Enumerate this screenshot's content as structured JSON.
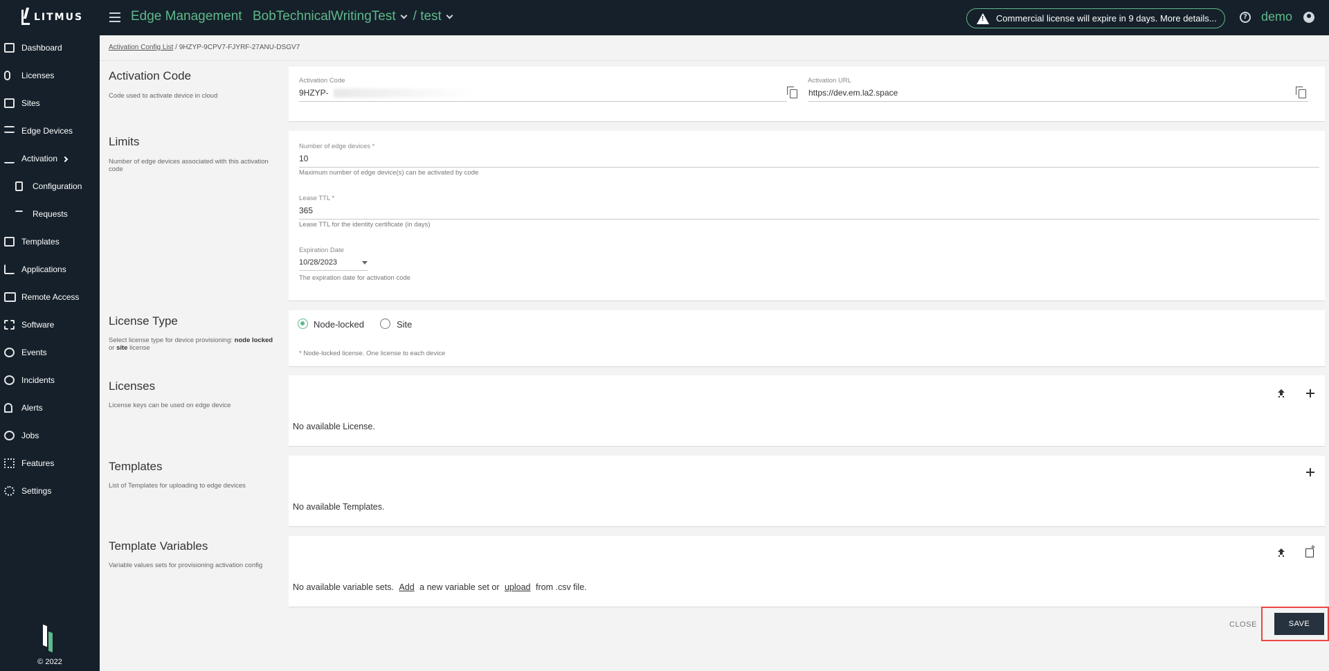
{
  "header": {
    "brand": "LITMUS",
    "app_title": "Edge Management",
    "company": "BobTechnicalWritingTest",
    "project": "/ test",
    "license_notice": "Commercial license will expire in 9 days. More details...",
    "user": "demo"
  },
  "sidebar": {
    "items": [
      {
        "label": "Dashboard",
        "icon": "dashboard-icon"
      },
      {
        "label": "Licenses",
        "icon": "paperclip-icon"
      },
      {
        "label": "Sites",
        "icon": "building-icon"
      },
      {
        "label": "Edge Devices",
        "icon": "list-icon"
      },
      {
        "label": "Activation",
        "icon": "checklist-icon"
      },
      {
        "label": "Configuration",
        "icon": "config-icon"
      },
      {
        "label": "Requests",
        "icon": "requests-icon"
      },
      {
        "label": "Templates",
        "icon": "template-icon"
      },
      {
        "label": "Applications",
        "icon": "cart-icon"
      },
      {
        "label": "Remote Access",
        "icon": "network-icon"
      },
      {
        "label": "Software",
        "icon": "chip-icon"
      },
      {
        "label": "Events",
        "icon": "history-icon"
      },
      {
        "label": "Incidents",
        "icon": "alert-circle-icon"
      },
      {
        "label": "Alerts",
        "icon": "bell-icon"
      },
      {
        "label": "Jobs",
        "icon": "clock-icon"
      },
      {
        "label": "Features",
        "icon": "apps-grid-icon"
      },
      {
        "label": "Settings",
        "icon": "gear-icon"
      }
    ],
    "copyright": "© 2022"
  },
  "breadcrumb": {
    "link": "Activation Config List",
    "current": "/ 9HZYP-9CPV7-FJYRF-27ANU-DSGV7"
  },
  "activation": {
    "title": "Activation Code",
    "desc": "Code used to activate device in cloud",
    "code_label": "Activation Code",
    "code_value": "9HZYP-",
    "url_label": "Activation URL",
    "url_value": "https://dev.em.la2.space"
  },
  "limits": {
    "title": "Limits",
    "desc": "Number of edge devices associated with this activation code",
    "devices_label": "Number of edge devices *",
    "devices_value": "10",
    "devices_hint": "Maximum number of edge device(s) can be activated by code",
    "ttl_label": "Lease TTL *",
    "ttl_value": "365",
    "ttl_hint": "Lease TTL for the identity certificate (in days)",
    "exp_label": "Expiration Date",
    "exp_value": "10/28/2023",
    "exp_hint": "The expiration date for activation code"
  },
  "license_type": {
    "title": "License Type",
    "desc_prefix": "Select license type for device provisioning: ",
    "desc_b1": "node locked",
    "desc_mid": " or ",
    "desc_b2": "site",
    "desc_suffix": " license",
    "opt_node": "Node-locked",
    "opt_site": "Site",
    "note": "* Node-locked license. One license to each device"
  },
  "licenses": {
    "title": "Licenses",
    "desc": "License keys can be used on edge device",
    "empty": "No available License."
  },
  "templates": {
    "title": "Templates",
    "desc": "List of Templates for uploading to edge devices",
    "empty": "No available Templates."
  },
  "template_vars": {
    "title": "Template Variables",
    "desc": "Variable values sets for provisioning activation config",
    "empty_prefix": "No available variable sets.",
    "add_link": "Add",
    "empty_mid": "a new variable set or",
    "upload_link": "upload",
    "empty_suffix": "from .csv file."
  },
  "actions": {
    "close": "CLOSE",
    "save": "SAVE"
  }
}
